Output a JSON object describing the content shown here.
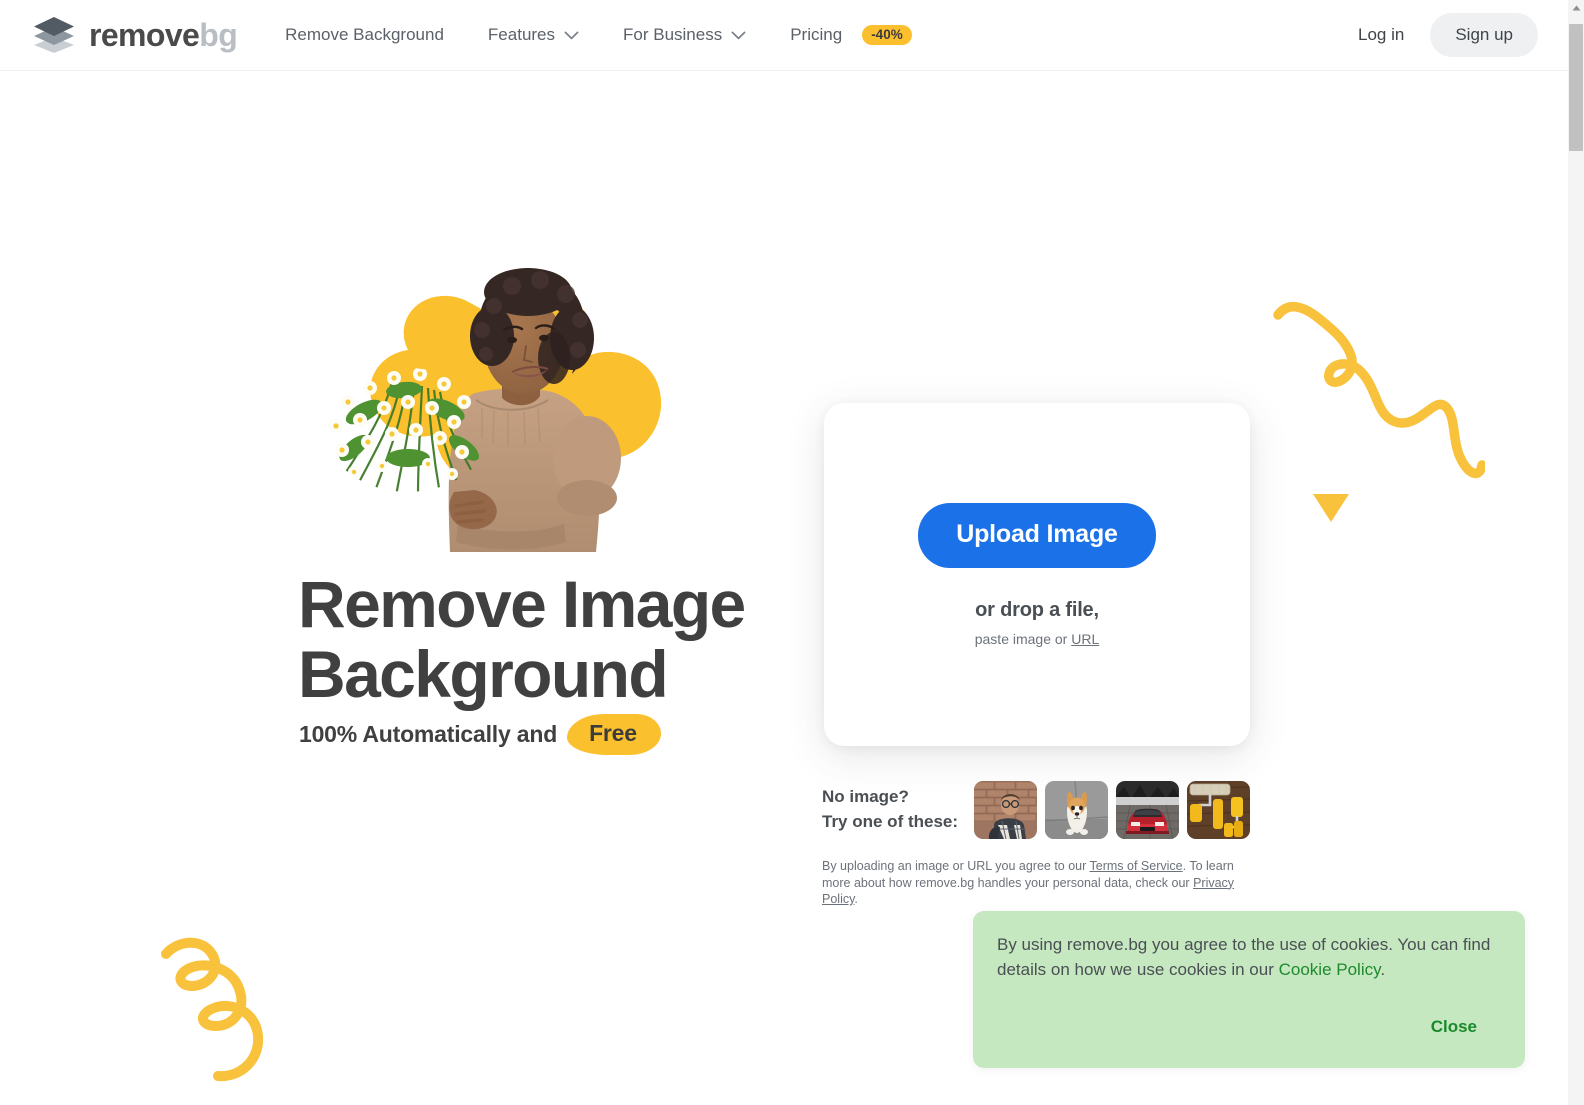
{
  "header": {
    "logo": {
      "icon": "layers-diamond-icon",
      "text_primary": "remove",
      "text_secondary": "bg"
    },
    "nav": [
      {
        "label": "Remove Background",
        "has_chevron": false,
        "badge": null
      },
      {
        "label": "Features",
        "has_chevron": true,
        "badge": null
      },
      {
        "label": "For Business",
        "has_chevron": true,
        "badge": null
      },
      {
        "label": "Pricing",
        "has_chevron": false,
        "badge": "-40%"
      }
    ],
    "login_label": "Log in",
    "signup_label": "Sign up"
  },
  "hero": {
    "headline": "Remove Image Background",
    "subline_prefix": "100% Automatically and",
    "subline_highlight": "Free",
    "image_alt": "woman holding chamomile bouquet"
  },
  "upload": {
    "button_label": "Upload Image",
    "drop_text": "or drop a file,",
    "paste_prefix": "paste image or ",
    "paste_link": "URL"
  },
  "samples": {
    "label_line1": "No image?",
    "label_line2": "Try one of these:",
    "thumbnails": [
      {
        "name": "sample-thumbnail-man-glasses"
      },
      {
        "name": "sample-thumbnail-corgi-dog"
      },
      {
        "name": "sample-thumbnail-red-car"
      },
      {
        "name": "sample-thumbnail-paint-rollers"
      }
    ]
  },
  "legal": {
    "part1": "By uploading an image or URL you agree to our ",
    "terms_link": "Terms of Service",
    "part2": ". To learn more about how remove.bg handles your personal data, check our ",
    "privacy_link": "Privacy Policy",
    "part3": "."
  },
  "cookie_banner": {
    "text_part1": "By using remove.bg you agree to the use of cookies. You can find details on how we use cookies in our ",
    "policy_link": "Cookie Policy",
    "text_part2": ".",
    "close_label": "Close"
  },
  "colors": {
    "accent_blue": "#1b72e8",
    "accent_yellow": "#fbc02d",
    "badge_yellow": "#fcc02e",
    "cookie_green_bg": "#c6e8c0",
    "cookie_green_text": "#1a8a2c",
    "text_dark": "#404040",
    "text_muted": "#6c727a",
    "logo_light": "#b9bec5"
  }
}
